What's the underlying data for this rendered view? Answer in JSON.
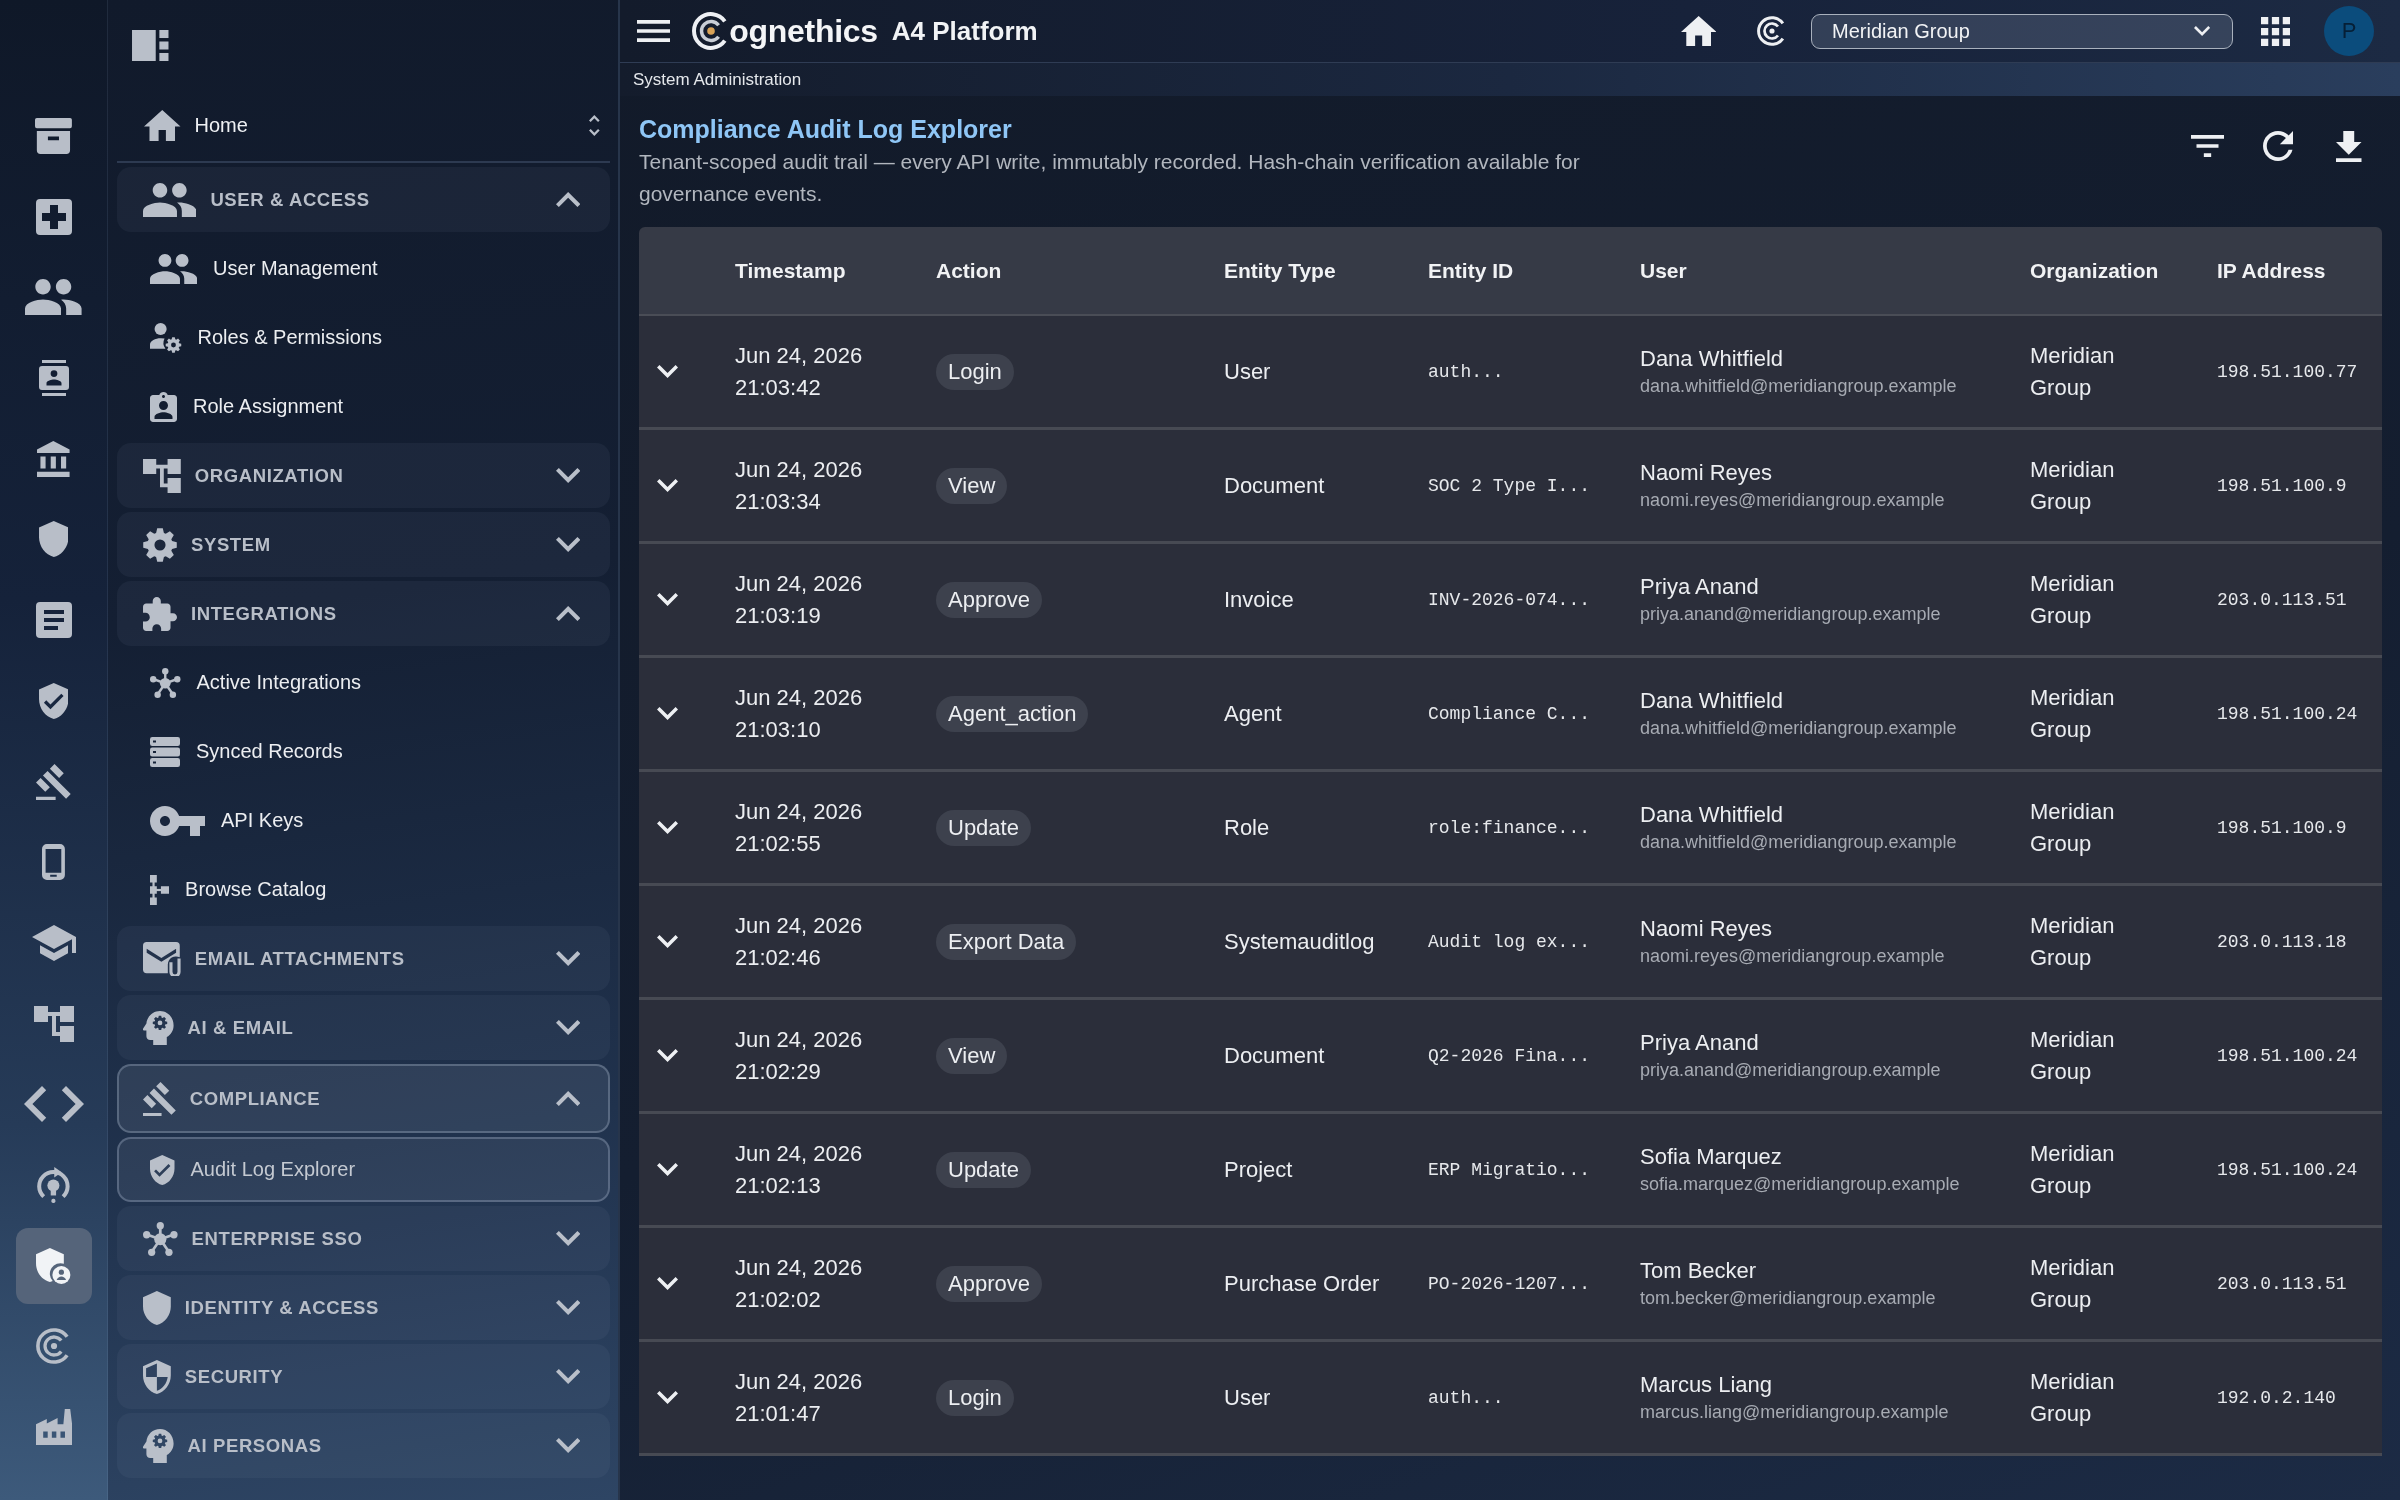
{
  "rail": {
    "items": [
      {
        "selected": false
      },
      {
        "selected": false
      },
      {
        "selected": false
      },
      {
        "selected": false
      },
      {
        "selected": false
      },
      {
        "selected": false
      },
      {
        "selected": false
      },
      {
        "selected": false
      },
      {
        "selected": false
      },
      {
        "selected": false
      },
      {
        "selected": false
      },
      {
        "selected": false
      },
      {
        "selected": false
      },
      {
        "selected": false
      },
      {
        "selected": true
      },
      {
        "selected": false
      },
      {
        "selected": false
      }
    ]
  },
  "sidebar": {
    "home": {
      "label": "Home"
    },
    "groups": [
      {
        "label": "USER & ACCESS",
        "expanded": true,
        "children": [
          {
            "label": "User Management",
            "selected": false
          },
          {
            "label": "Roles & Permissions",
            "selected": false
          },
          {
            "label": "Role Assignment",
            "selected": false
          }
        ]
      },
      {
        "label": "ORGANIZATION",
        "expanded": false
      },
      {
        "label": "SYSTEM",
        "expanded": false
      },
      {
        "label": "INTEGRATIONS",
        "expanded": true,
        "children": [
          {
            "label": "Active Integrations",
            "selected": false
          },
          {
            "label": "Synced Records",
            "selected": false
          },
          {
            "label": "API Keys",
            "selected": false
          },
          {
            "label": "Browse Catalog",
            "selected": false
          }
        ]
      },
      {
        "label": "EMAIL ATTACHMENTS",
        "expanded": false
      },
      {
        "label": "AI & EMAIL",
        "expanded": false
      },
      {
        "label": "COMPLIANCE",
        "expanded": true,
        "children": [
          {
            "label": "Audit Log Explorer",
            "selected": true
          }
        ]
      },
      {
        "label": "ENTERPRISE SSO",
        "expanded": false
      },
      {
        "label": "IDENTITY & ACCESS",
        "expanded": false
      },
      {
        "label": "SECURITY",
        "expanded": false
      },
      {
        "label": "AI PERSONAS",
        "expanded": false
      }
    ]
  },
  "topbar": {
    "brand": "ognethics",
    "product": "A4 Platform",
    "organization_select": {
      "value": "Meridian Group"
    },
    "avatar": "P"
  },
  "breadcrumb": "System Administration",
  "page": {
    "title": "Compliance Audit Log Explorer",
    "description": "Tenant-scoped audit trail — every API write, immutably recorded. Hash-chain verification available for governance events."
  },
  "table": {
    "columns": [
      "Timestamp",
      "Action",
      "Entity Type",
      "Entity ID",
      "User",
      "Organization",
      "IP Address"
    ],
    "rows": [
      {
        "expanded": false,
        "timestamp": "Jun 24, 2026 21:03:42",
        "action": "Login",
        "entity_type": "User",
        "entity_id": "auth...",
        "user": "Dana Whitfield",
        "email": "dana.whitfield@meridiangroup.example",
        "organization": "Meridian Group",
        "ip_address": "198.51.100.77"
      },
      {
        "expanded": false,
        "timestamp": "Jun 24, 2026 21:03:34",
        "action": "View",
        "entity_type": "Document",
        "entity_id": "SOC 2 Type I...",
        "user": "Naomi Reyes",
        "email": "naomi.reyes@meridiangroup.example",
        "organization": "Meridian Group",
        "ip_address": "198.51.100.9"
      },
      {
        "expanded": false,
        "timestamp": "Jun 24, 2026 21:03:19",
        "action": "Approve",
        "entity_type": "Invoice",
        "entity_id": "INV-2026-074...",
        "user": "Priya Anand",
        "email": "priya.anand@meridiangroup.example",
        "organization": "Meridian Group",
        "ip_address": "203.0.113.51"
      },
      {
        "expanded": false,
        "timestamp": "Jun 24, 2026 21:03:10",
        "action": "Agent_action",
        "entity_type": "Agent",
        "entity_id": "Compliance C...",
        "user": "Dana Whitfield",
        "email": "dana.whitfield@meridiangroup.example",
        "organization": "Meridian Group",
        "ip_address": "198.51.100.24"
      },
      {
        "expanded": false,
        "timestamp": "Jun 24, 2026 21:02:55",
        "action": "Update",
        "entity_type": "Role",
        "entity_id": "role:finance...",
        "user": "Dana Whitfield",
        "email": "dana.whitfield@meridiangroup.example",
        "organization": "Meridian Group",
        "ip_address": "198.51.100.9"
      },
      {
        "expanded": false,
        "timestamp": "Jun 24, 2026 21:02:46",
        "action": "Export Data",
        "entity_type": "Systemauditlog",
        "entity_id": "Audit log ex...",
        "user": "Naomi Reyes",
        "email": "naomi.reyes@meridiangroup.example",
        "organization": "Meridian Group",
        "ip_address": "203.0.113.18"
      },
      {
        "expanded": false,
        "timestamp": "Jun 24, 2026 21:02:29",
        "action": "View",
        "entity_type": "Document",
        "entity_id": "Q2-2026 Fina...",
        "user": "Priya Anand",
        "email": "priya.anand@meridiangroup.example",
        "organization": "Meridian Group",
        "ip_address": "198.51.100.24"
      },
      {
        "expanded": false,
        "timestamp": "Jun 24, 2026 21:02:13",
        "action": "Update",
        "entity_type": "Project",
        "entity_id": "ERP Migratio...",
        "user": "Sofia Marquez",
        "email": "sofia.marquez@meridiangroup.example",
        "organization": "Meridian Group",
        "ip_address": "198.51.100.24"
      },
      {
        "expanded": false,
        "timestamp": "Jun 24, 2026 21:02:02",
        "action": "Approve",
        "entity_type": "Purchase Order",
        "entity_id": "PO-2026-1207...",
        "user": "Tom Becker",
        "email": "tom.becker@meridiangroup.example",
        "organization": "Meridian Group",
        "ip_address": "203.0.113.51"
      },
      {
        "expanded": false,
        "timestamp": "Jun 24, 2026 21:01:47",
        "action": "Login",
        "entity_type": "User",
        "entity_id": "auth...",
        "user": "Marcus Liang",
        "email": "marcus.liang@meridiangroup.example",
        "organization": "Meridian Group",
        "ip_address": "192.0.2.140"
      }
    ]
  }
}
